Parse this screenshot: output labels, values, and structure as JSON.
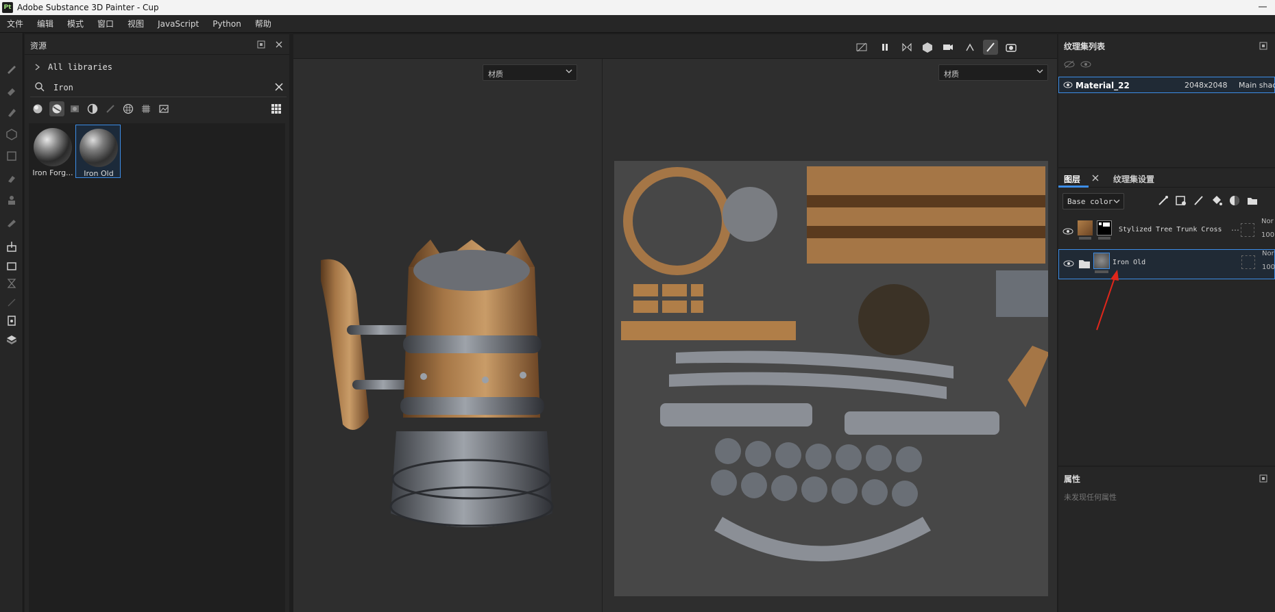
{
  "window": {
    "title": "Adobe Substance 3D Painter - Cup",
    "logo": "Pt"
  },
  "menu": [
    "文件",
    "编辑",
    "模式",
    "窗口",
    "视图",
    "JavaScript",
    "Python",
    "帮助"
  ],
  "assets": {
    "title": "资源",
    "library": "All libraries",
    "search_value": "Iron",
    "items": [
      {
        "label": "Iron Forg..."
      },
      {
        "label": "Iron Old"
      }
    ]
  },
  "viewport": {
    "left_dropdown": "材质",
    "right_dropdown": "材质"
  },
  "texture_set": {
    "title": "纹理集列表",
    "row": {
      "name": "Material_22",
      "size": "2048x2048",
      "shader": "Main shac"
    }
  },
  "layers": {
    "tab_layers": "图层",
    "tab_settings": "纹理集设置",
    "channel": "Base color",
    "rows": [
      {
        "name": "Stylized Tree Trunk Cross",
        "blend": "Nor",
        "opacity": "100"
      },
      {
        "name": "Iron Old",
        "blend": "Nor",
        "opacity": "100"
      }
    ]
  },
  "properties": {
    "title": "属性",
    "empty_text": "未发现任何属性"
  },
  "colors": {
    "accent": "#3d8ee8",
    "panel": "#262626",
    "viewport": "#2e2e2e",
    "annotation": "#e0261b"
  }
}
